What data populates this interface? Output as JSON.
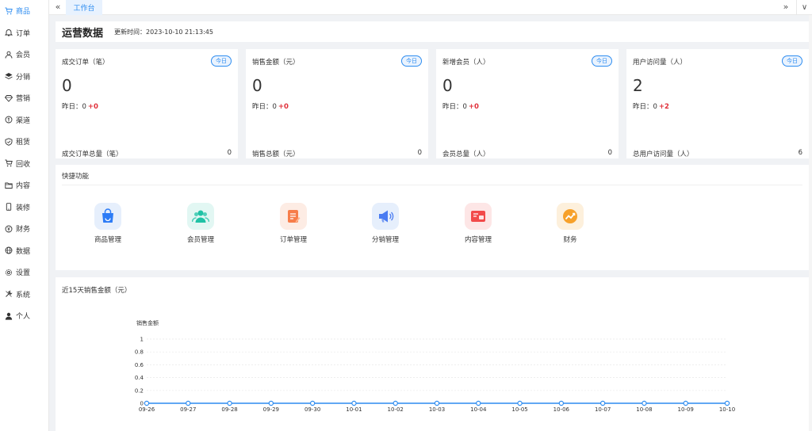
{
  "sidebar": {
    "items": [
      {
        "label": "商品",
        "icon": "cart-icon",
        "active": true
      },
      {
        "label": "订单",
        "icon": "bell-icon"
      },
      {
        "label": "会员",
        "icon": "user-icon"
      },
      {
        "label": "分销",
        "icon": "layers-icon"
      },
      {
        "label": "营销",
        "icon": "diamond-icon"
      },
      {
        "label": "渠道",
        "icon": "coin-icon"
      },
      {
        "label": "租赁",
        "icon": "shield-icon"
      },
      {
        "label": "回收",
        "icon": "cart-icon"
      },
      {
        "label": "内容",
        "icon": "folder-icon"
      },
      {
        "label": "装修",
        "icon": "phone-icon"
      },
      {
        "label": "财务",
        "icon": "yen-icon"
      },
      {
        "label": "数据",
        "icon": "globe-icon"
      },
      {
        "label": "设置",
        "icon": "gear-icon"
      },
      {
        "label": "系统",
        "icon": "tools-icon"
      },
      {
        "label": "个人",
        "icon": "person-icon"
      }
    ]
  },
  "topbar": {
    "tab_label": "工作台"
  },
  "ops": {
    "title": "运营数据",
    "update_time": "更新时间：2023-10-10 21:13:45"
  },
  "cards": [
    {
      "title": "成交订单（笔）",
      "badge": "今日",
      "value": "0",
      "yest_label": "昨日：0",
      "yest_delta": "+0",
      "total_label": "成交订单总量（笔）",
      "total_value": "0"
    },
    {
      "title": "销售金额（元）",
      "badge": "今日",
      "value": "0",
      "yest_label": "昨日：0",
      "yest_delta": "+0",
      "total_label": "销售总额（元）",
      "total_value": "0"
    },
    {
      "title": "新增会员（人）",
      "badge": "今日",
      "value": "0",
      "yest_label": "昨日：0",
      "yest_delta": "+0",
      "total_label": "会员总量（人）",
      "total_value": "0"
    },
    {
      "title": "用户访问量（人）",
      "badge": "今日",
      "value": "2",
      "yest_label": "昨日：0",
      "yest_delta": "+2",
      "total_label": "总用户访问量（人）",
      "total_value": "6"
    }
  ],
  "quick": {
    "title": "快捷功能",
    "items": [
      {
        "label": "商品管理",
        "icon": "shopping-bag-icon",
        "bg": "#e6effc",
        "color": "#2d7cf6"
      },
      {
        "label": "会员管理",
        "icon": "members-icon",
        "bg": "#e2f7f3",
        "color": "#1fc2a5"
      },
      {
        "label": "订单管理",
        "icon": "order-icon",
        "bg": "#fdece4",
        "color": "#f77d4a"
      },
      {
        "label": "分销管理",
        "icon": "megaphone-icon",
        "bg": "#e6effc",
        "color": "#4a7cf2"
      },
      {
        "label": "内容管理",
        "icon": "content-icon",
        "bg": "#fde6e6",
        "color": "#f24a4a"
      },
      {
        "label": "财务",
        "icon": "finance-icon",
        "bg": "#fdf0dc",
        "color": "#f7a12a"
      }
    ]
  },
  "chart_data": {
    "type": "line",
    "title": "近15天销售金额（元）",
    "ylabel": "销售金额",
    "xlabel": "",
    "categories": [
      "09-26",
      "09-27",
      "09-28",
      "09-29",
      "09-30",
      "10-01",
      "10-02",
      "10-03",
      "10-04",
      "10-05",
      "10-06",
      "10-07",
      "10-08",
      "10-09",
      "10-10"
    ],
    "values": [
      0,
      0,
      0,
      0,
      0,
      0,
      0,
      0,
      0,
      0,
      0,
      0,
      0,
      0,
      0
    ],
    "yticks": [
      "0",
      "0.2",
      "0.4",
      "0.6",
      "0.8",
      "1"
    ],
    "ylim": [
      0,
      1
    ],
    "color": "#2d8cf0",
    "grid": true
  }
}
